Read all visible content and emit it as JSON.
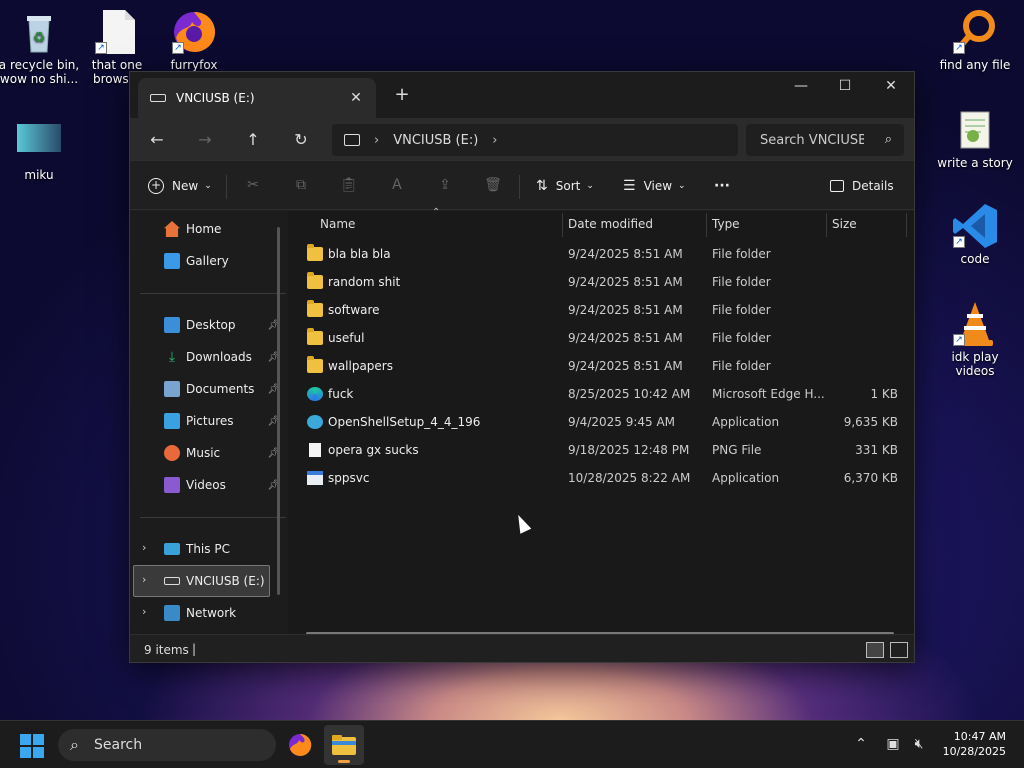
{
  "desktop": {
    "icons": [
      {
        "label": "a recycle bin, wow no shi...",
        "icon": "recycle-bin-icon"
      },
      {
        "label": "that one browser",
        "icon": "blank-file-icon"
      },
      {
        "label": "furryfox",
        "icon": "firefox-icon"
      },
      {
        "label": "miku",
        "icon": "image-thumbnail-icon"
      },
      {
        "label": "find any file",
        "icon": "search-app-icon"
      },
      {
        "label": "write a story",
        "icon": "notepad-icon"
      },
      {
        "label": "code",
        "icon": "vscode-icon"
      },
      {
        "label": "idk play videos",
        "icon": "vlc-icon"
      }
    ]
  },
  "window": {
    "tab_title": "VNCIUSB (E:)",
    "new_tab": "+",
    "controls": {
      "minimize": "—",
      "maximize": "☐",
      "close": "✕"
    }
  },
  "nav": {
    "back": "←",
    "forward": "→",
    "up": "↑",
    "refresh": "↻",
    "breadcrumb": "VNCIUSB (E:)",
    "search_placeholder": "Search VNCIUSB"
  },
  "toolbar": {
    "new_label": "New",
    "sort_label": "Sort",
    "view_label": "View",
    "more_label": "···",
    "details_label": "Details"
  },
  "sidebar": {
    "quick": [
      {
        "label": "Home",
        "color": "#e8733a"
      },
      {
        "label": "Gallery",
        "color": "#3b9ae8"
      }
    ],
    "pinned": [
      {
        "label": "Desktop",
        "color": "#3b8fd8"
      },
      {
        "label": "Downloads",
        "color": "#2fb36a"
      },
      {
        "label": "Documents",
        "color": "#7aa3d0"
      },
      {
        "label": "Pictures",
        "color": "#3aa0e0"
      },
      {
        "label": "Music",
        "color": "#e86a3a"
      },
      {
        "label": "Videos",
        "color": "#8a5ad0"
      }
    ],
    "tree": [
      {
        "label": "This PC"
      },
      {
        "label": "VNCIUSB (E:)"
      },
      {
        "label": "Network"
      }
    ]
  },
  "columns": {
    "name": "Name",
    "date": "Date modified",
    "type": "Type",
    "size": "Size"
  },
  "files": [
    {
      "name": "bla bla bla",
      "date": "9/24/2025 8:51 AM",
      "type": "File folder",
      "size": "",
      "icon": "folder-icon"
    },
    {
      "name": "random shit",
      "date": "9/24/2025 8:51 AM",
      "type": "File folder",
      "size": "",
      "icon": "folder-icon"
    },
    {
      "name": "software",
      "date": "9/24/2025 8:51 AM",
      "type": "File folder",
      "size": "",
      "icon": "folder-icon"
    },
    {
      "name": "useful",
      "date": "9/24/2025 8:51 AM",
      "type": "File folder",
      "size": "",
      "icon": "folder-icon"
    },
    {
      "name": "wallpapers",
      "date": "9/24/2025 8:51 AM",
      "type": "File folder",
      "size": "",
      "icon": "folder-icon"
    },
    {
      "name": "fuck",
      "date": "8/25/2025 10:42 AM",
      "type": "Microsoft Edge H...",
      "size": "1 KB",
      "icon": "edge-icon"
    },
    {
      "name": "OpenShellSetup_4_4_196",
      "date": "9/4/2025 9:45 AM",
      "type": "Application",
      "size": "9,635 KB",
      "icon": "setup-icon"
    },
    {
      "name": "opera gx sucks",
      "date": "9/18/2025 12:48 PM",
      "type": "PNG File",
      "size": "331 KB",
      "icon": "png-file-icon"
    },
    {
      "name": "sppsvc",
      "date": "10/28/2025 8:22 AM",
      "type": "Application",
      "size": "6,370 KB",
      "icon": "app-icon"
    }
  ],
  "status": {
    "item_count": "9 items",
    "cursor": "|"
  },
  "taskbar": {
    "search_label": "Search",
    "time": "10:47 AM",
    "date": "10/28/2025"
  }
}
